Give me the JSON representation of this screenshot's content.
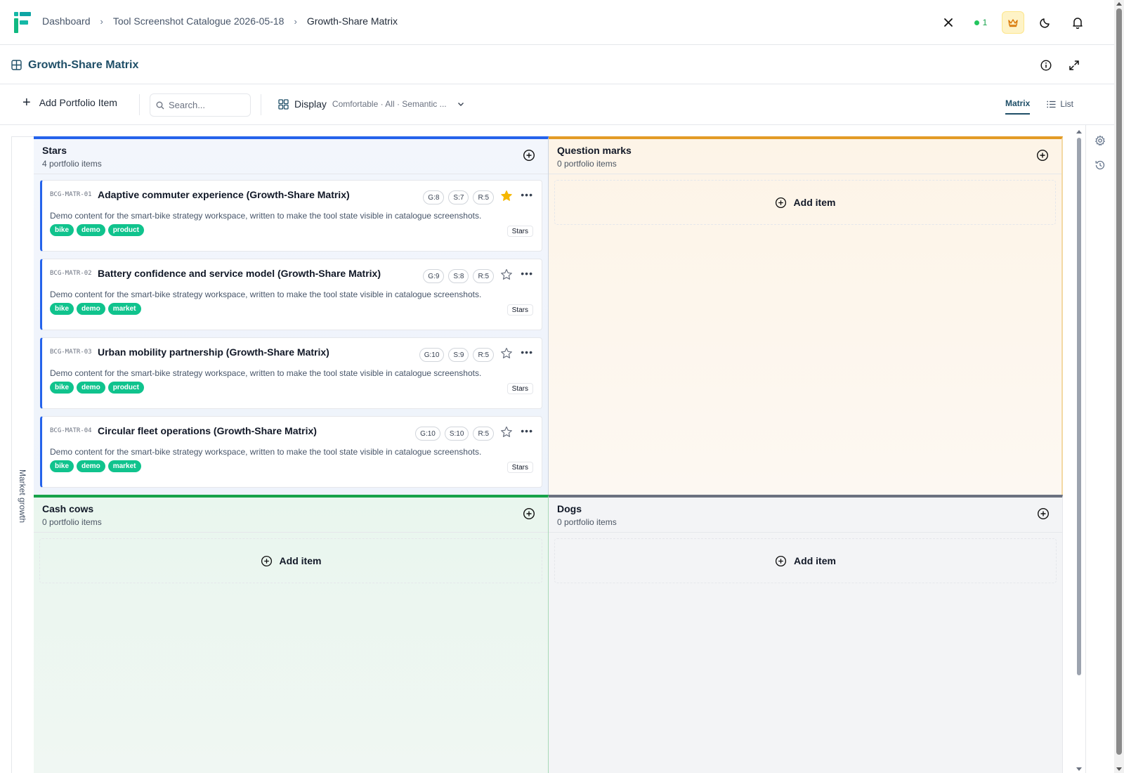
{
  "breadcrumbs": [
    "Dashboard",
    "Tool Screenshot Catalogue 2026-05-18",
    "Growth-Share Matrix"
  ],
  "header": {
    "online_count": "1"
  },
  "page": {
    "title": "Growth-Share Matrix"
  },
  "toolbar": {
    "add_label": "Add Portfolio Item",
    "search_placeholder": "Search...",
    "display_label": "Display",
    "display_summary": "Comfortable · All · Semantic ...",
    "tabs": [
      {
        "label": "Matrix",
        "active": true
      },
      {
        "label": "List",
        "active": false
      }
    ]
  },
  "matrix": {
    "axis_label": "Market growth",
    "add_item_label": "Add item",
    "quadrants": [
      {
        "name": "Stars",
        "count": "4 portfolio items",
        "color": "#2563eb"
      },
      {
        "name": "Question marks",
        "count": "0 portfolio items",
        "color": "#e39b25"
      },
      {
        "name": "Cash cows",
        "count": "0 portfolio items",
        "color": "#17a24a"
      },
      {
        "name": "Dogs",
        "count": "0 portfolio items",
        "color": "#6b7280"
      }
    ]
  },
  "cards": [
    {
      "code": "BCG-MATR-01",
      "title": "Adaptive commuter experience (Growth-Share Matrix)",
      "g": "G:8",
      "s": "S:7",
      "r": "R:5",
      "starred": true,
      "description": "Demo content for the smart-bike strategy workspace, written to make the tool state visible in catalogue screenshots.",
      "tags": [
        "bike",
        "demo",
        "product"
      ],
      "quadrant": "Stars"
    },
    {
      "code": "BCG-MATR-02",
      "title": "Battery confidence and service model (Growth-Share Matrix)",
      "g": "G:9",
      "s": "S:8",
      "r": "R:5",
      "starred": false,
      "description": "Demo content for the smart-bike strategy workspace, written to make the tool state visible in catalogue screenshots.",
      "tags": [
        "bike",
        "demo",
        "market"
      ],
      "quadrant": "Stars"
    },
    {
      "code": "BCG-MATR-03",
      "title": "Urban mobility partnership (Growth-Share Matrix)",
      "g": "G:10",
      "s": "S:9",
      "r": "R:5",
      "starred": false,
      "description": "Demo content for the smart-bike strategy workspace, written to make the tool state visible in catalogue screenshots.",
      "tags": [
        "bike",
        "demo",
        "product"
      ],
      "quadrant": "Stars"
    },
    {
      "code": "BCG-MATR-04",
      "title": "Circular fleet operations (Growth-Share Matrix)",
      "g": "G:10",
      "s": "S:10",
      "r": "R:5",
      "starred": false,
      "description": "Demo content for the smart-bike strategy workspace, written to make the tool state visible in catalogue screenshots.",
      "tags": [
        "bike",
        "demo",
        "market"
      ],
      "quadrant": "Stars"
    }
  ],
  "colors": {
    "accent": "#1e4e67",
    "tag": "#10c38d",
    "star": "#f5b700"
  },
  "icons": [
    "app-logo",
    "chevron-right-icon",
    "close-icon",
    "crown-icon",
    "moon-icon",
    "bell-icon",
    "grid-icon",
    "info-icon",
    "expand-icon",
    "plus-icon",
    "search-icon",
    "layout-grid-icon",
    "chevron-down-icon",
    "list-icon",
    "plus-circle-icon",
    "star-icon",
    "more-icon",
    "settings-icon",
    "history-icon"
  ]
}
